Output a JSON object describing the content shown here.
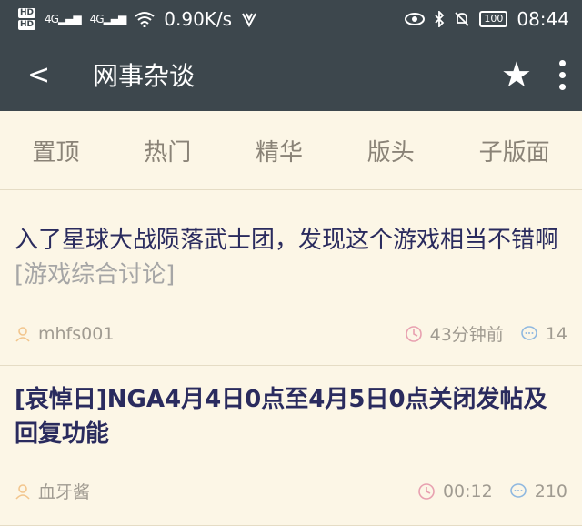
{
  "status_bar": {
    "hd1": "HD",
    "hd2": "HD",
    "net1": "4G",
    "net2": "4G",
    "speed": "0.90K/s",
    "battery": "100",
    "time": "08:44"
  },
  "app_bar": {
    "title": "网事杂谈"
  },
  "tabs": [
    "置顶",
    "热门",
    "精华",
    "版头",
    "子版面"
  ],
  "posts": [
    {
      "title": "入了星球大战陨落武士团，发现这个游戏相当不错啊",
      "forum": "[游戏综合讨论]",
      "author": "mhfs001",
      "time": "43分钟前",
      "replies": "14"
    },
    {
      "title": "[哀悼日]NGA4月4日0点至4月5日0点关闭发帖及回复功能",
      "author": "血牙酱",
      "time": "00:12",
      "replies": "210"
    }
  ],
  "colors": {
    "header_bg": "#3d474d",
    "page_bg": "#fcf6e6",
    "title_text": "#2a2b5e",
    "author_icon": "#f2c58c",
    "time_icon": "#e8a0b0",
    "reply_icon": "#8fb8e0"
  }
}
